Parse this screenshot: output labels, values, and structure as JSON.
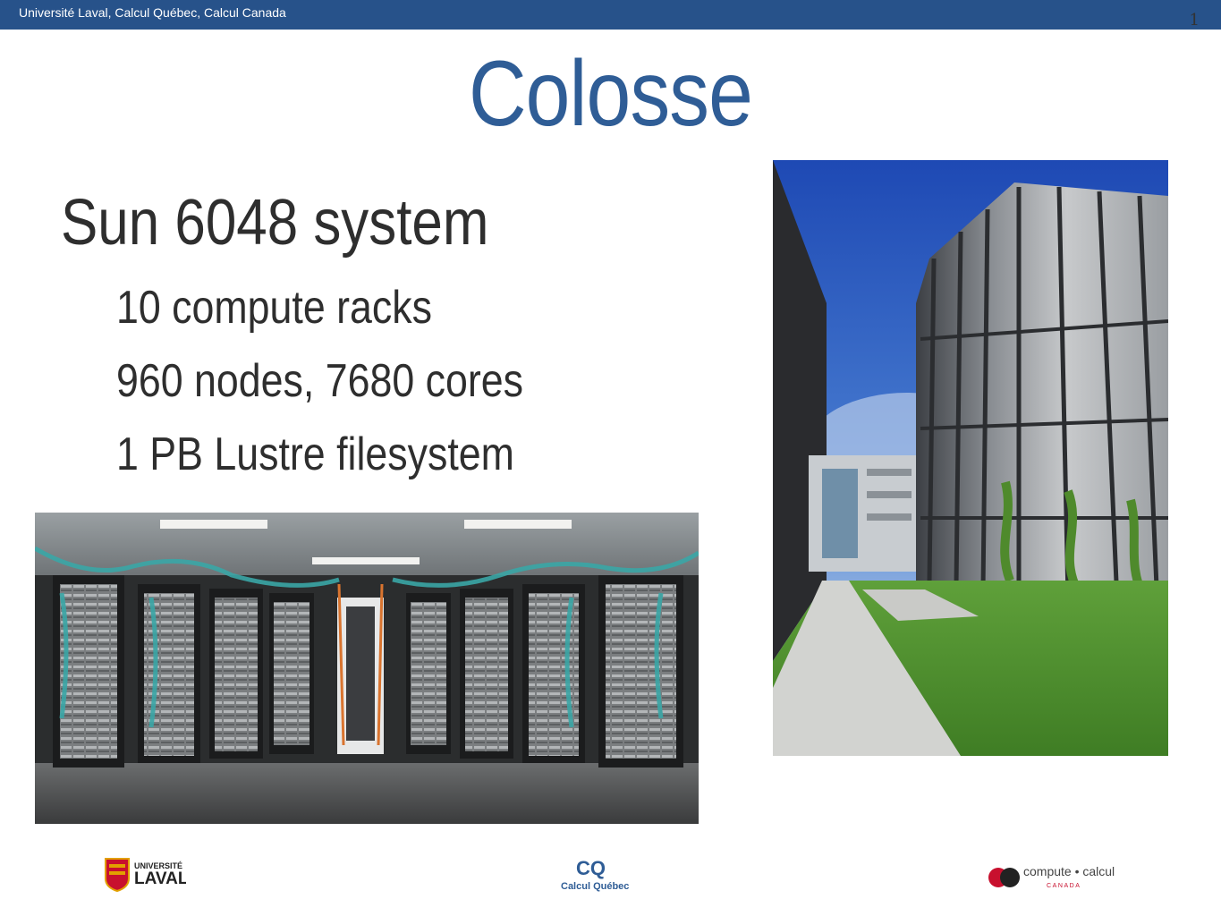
{
  "header": {
    "org_text": "Université Laval, Calcul Québec, Calcul Canada",
    "slide_number": "1"
  },
  "slide": {
    "title": "Colosse",
    "main_bullet": "Sun 6048 system",
    "sub_bullets": [
      "10 compute racks",
      "960 nodes, 7680 cores",
      "1 PB Lustre filesystem"
    ]
  },
  "logos": {
    "laval": {
      "line1": "UNIVERSITÉ",
      "line2": "LAVAL"
    },
    "calcul_quebec": {
      "mark": "CQ",
      "text": "Calcul Québec"
    },
    "compute_canada": {
      "line1": "compute • calcul",
      "line2": "C A N A D A"
    }
  },
  "colors": {
    "accent": "#27528a",
    "title": "#2f5d96",
    "text": "#2e2e2e"
  }
}
